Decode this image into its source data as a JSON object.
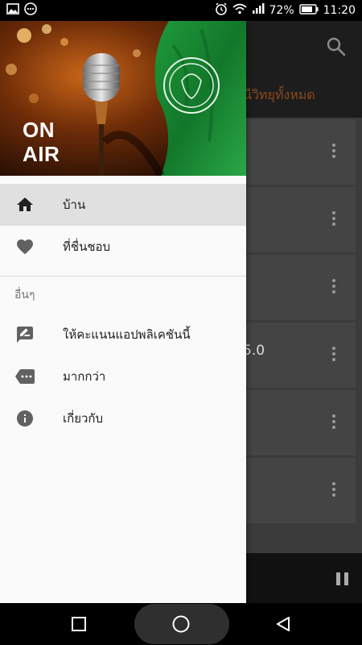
{
  "status_bar": {
    "battery_percent": "72%",
    "time": "11:20",
    "icons": [
      "image-notification-icon",
      "chat-notification-icon",
      "alarm-icon",
      "wifi-icon",
      "signal-icon",
      "battery-icon"
    ]
  },
  "drawer": {
    "header": {
      "banner_text_line1": "ON",
      "banner_text_line2": "AIR"
    },
    "items": [
      {
        "label": "บ้าน",
        "icon": "home-icon",
        "active": true
      },
      {
        "label": "ที่ชื่นชอบ",
        "icon": "heart-icon",
        "active": false
      }
    ],
    "section_title": "อื่นๆ",
    "other_items": [
      {
        "label": "ให้คะแนนแอปพลิเคชันนี้",
        "icon": "rate-review-icon"
      },
      {
        "label": "มากกว่า",
        "icon": "more-tag-icon"
      },
      {
        "label": "เกี่ยวกับ",
        "icon": "info-icon"
      }
    ]
  },
  "background_app": {
    "tab_label": "นีวิทยุทั้งหมด",
    "partial_card_value": "5.0",
    "search_icon": "search-icon",
    "pause_icon": "pause-icon"
  },
  "navigation_bar": {
    "buttons": [
      "recents-square-icon",
      "home-circle-icon",
      "back-triangle-icon"
    ]
  },
  "colors": {
    "drawer_bg": "#fafafa",
    "active_item_bg": "#e0e0e0",
    "icon_gray": "#616161",
    "tab_accent": "#8a4a1a"
  }
}
